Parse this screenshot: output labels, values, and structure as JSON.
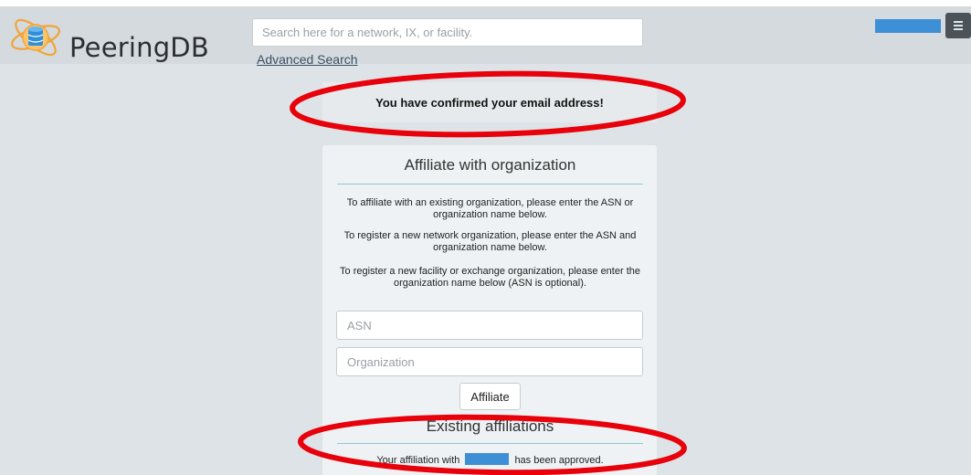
{
  "header": {
    "logo_text": "PeeringDB",
    "search": {
      "placeholder": "Search here for a network, IX, or facility.",
      "value": ""
    },
    "advanced_search_label": "Advanced Search",
    "user_menu_color": "#3d8fd6",
    "menu_icon": "hamburger-icon"
  },
  "notice": {
    "text": "You have confirmed your email address!"
  },
  "affiliate_panel": {
    "title": "Affiliate with organization",
    "paragraphs": [
      "To affiliate with an existing organization, please enter the ASN or organization name below.",
      "To register a new network organization, please enter the ASN and organization name below.",
      "To register a new facility or exchange organization, please enter the organization name below (ASN is optional)."
    ],
    "asn_placeholder": "ASN",
    "organization_placeholder": "Organization",
    "affiliate_button": "Affiliate"
  },
  "existing": {
    "title": "Existing affiliations",
    "prefix": "Your affiliation with",
    "suffix": "has been approved."
  },
  "colors": {
    "accent": "#3d8fd6",
    "annotation": "#e8000b",
    "divider": "#8fc9d4"
  }
}
